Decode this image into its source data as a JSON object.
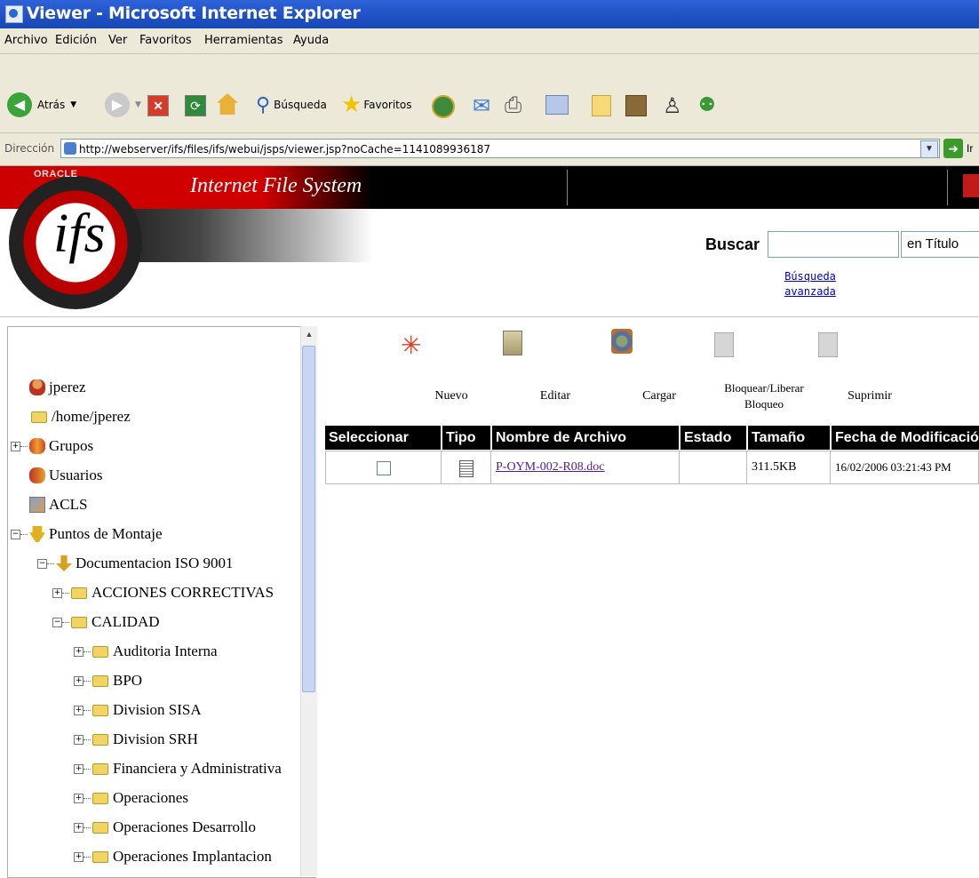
{
  "window": {
    "title": "Viewer - Microsoft Internet Explorer"
  },
  "menu": [
    "Archivo",
    "Edición",
    "Ver",
    "Favoritos",
    "Herramientas",
    "Ayuda"
  ],
  "toolbar": {
    "back": "Atrás",
    "search": "Búsqueda",
    "favorites": "Favoritos"
  },
  "address": {
    "label": "Dirección",
    "url": "http://webserver/ifs/files/ifs/webui/jsps/viewer.jsp?noCache=1141089936187",
    "go": "Ir"
  },
  "header": {
    "oracle": "ORACLE",
    "app_title": "Internet File System",
    "logo": "ifs"
  },
  "search": {
    "label": "Buscar",
    "value": "",
    "scope": "en Título",
    "advanced_line1": "Búsqueda",
    "advanced_line2": "avanzada"
  },
  "tree": {
    "user": "jperez",
    "home": "/home/jperez",
    "groups": "Grupos",
    "users": "Usuarios",
    "acls": "ACLS",
    "mounts": "Puntos de Montaje",
    "doc_iso": "Documentacion ISO 9001",
    "acciones": "ACCIONES CORRECTIVAS",
    "calidad": "CALIDAD",
    "children": [
      "Auditoria Interna",
      "BPO",
      "Division SISA",
      "Division SRH",
      "Financiera y Administrativa",
      "Operaciones",
      "Operaciones Desarrollo",
      "Operaciones Implantacion"
    ]
  },
  "actions": {
    "new": "Nuevo",
    "edit": "Editar",
    "upload": "Cargar",
    "lock_line1": "Bloquear/Liberar",
    "lock_line2": "Bloqueo",
    "delete": "Suprimir"
  },
  "table": {
    "headers": [
      "Seleccionar",
      "Tipo",
      "Nombre de Archivo",
      "Estado",
      "Tamaño",
      "Fecha de Modificación"
    ],
    "rows": [
      {
        "name": "P-OYM-002-R08.doc",
        "state": "",
        "size": "311.5KB",
        "modified": "16/02/2006 03:21:43 PM"
      }
    ]
  }
}
